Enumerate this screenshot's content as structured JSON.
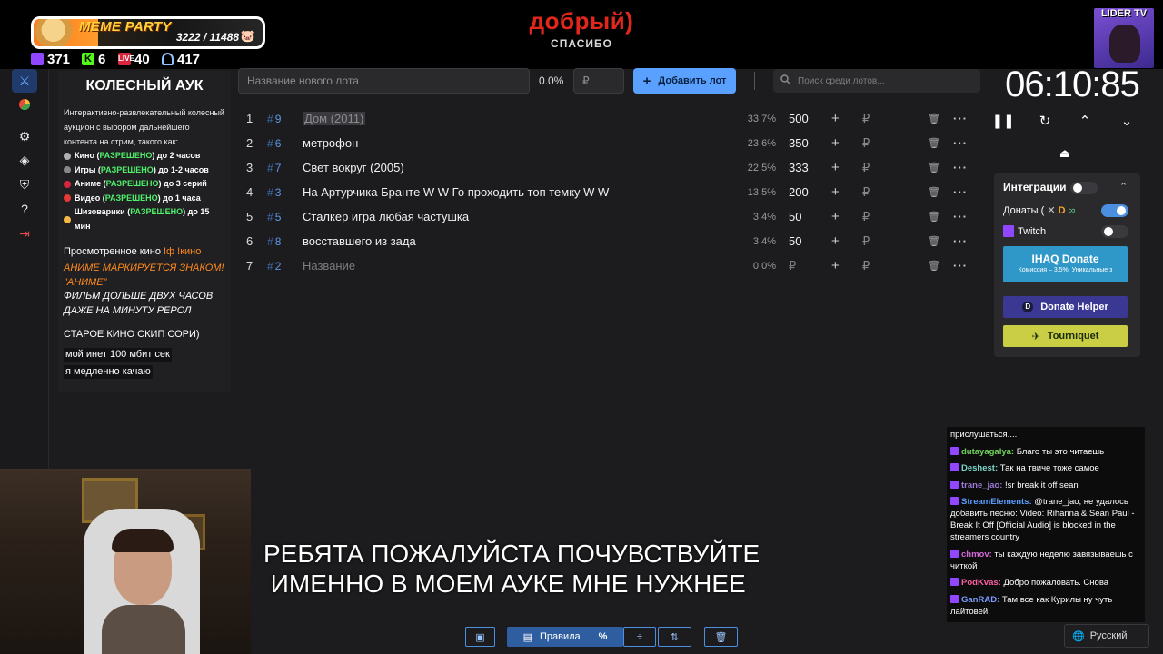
{
  "overlay": {
    "meme_party": {
      "title": "MEME PARTY",
      "count": "3222 / 11488",
      "progress": 0.28,
      "pig": "🐷"
    },
    "stats": {
      "twitch": "371",
      "kick": "6",
      "vk": "40",
      "viewers": "417",
      "vk_badge": "LIVE",
      "kick_badge": "K"
    },
    "thanks": {
      "main": "добрый)",
      "sub": "СПАСИБО"
    },
    "lider": {
      "label": "LIDER TV"
    }
  },
  "sidebar": {
    "icons": [
      "wheel-icon",
      "pie-chart-icon",
      "gear-icon",
      "layers-icon",
      "shield-icon",
      "help-icon",
      "logout-icon"
    ]
  },
  "description": {
    "title": "КОЛЕСНЫЙ АУК",
    "intro": "Интерактивно-развлекательный колесный аукцион с выбором дальнейшего контента на стрим, такого как:",
    "rules": [
      {
        "pre": "Кино (",
        "ok": "РАЗРЕШЕНО",
        "post": ") до 2 часов",
        "color": "#b0b0b0"
      },
      {
        "pre": "Игры (",
        "ok": "РАЗРЕШЕНО",
        "post": ") до 1-2 часов",
        "color": "#888888"
      },
      {
        "pre": "Аниме (",
        "ok": "РАЗРЕШЕНО",
        "post": ") до 3 серий",
        "color": "#d9263f"
      },
      {
        "pre": "Видео (",
        "ok": "РАЗРЕШЕНО",
        "post": ") до 1 часа",
        "color": "#e53935"
      },
      {
        "pre": "Шизоварики (",
        "ok": "РАЗРЕШЕНО",
        "post": ") до 15 мин",
        "color": "#f5b942"
      }
    ],
    "watched_label": "Просмотренное кино ",
    "watched_cmd": "!ф !кино",
    "orange_lines": [
      "АНИМЕ МАРКИРУЕТСЯ ЗНАКОМ!",
      "\"АНИМЕ\""
    ],
    "white_lines": [
      "ФИЛЬМ ДОЛЬШЕ ДВУХ ЧАСОВ",
      "ДАЖЕ НА МИНУТУ РЕРОЛ"
    ],
    "old_movies": "СТАРОЕ КИНО СКИП СОРИ)",
    "boxed_lines": [
      "мой инет 100 мбит сек",
      "я медленно качаю"
    ]
  },
  "controls": {
    "lot_placeholder": "Название нового лота",
    "total_percent": "0.0%",
    "amount_placeholder": "₽",
    "add_lot_label": "Добавить лот",
    "search_placeholder": "Поиск среди лотов..."
  },
  "lots": [
    {
      "idx": "1",
      "fid": "9",
      "name": "Дом (2011)",
      "pct": "33.7%",
      "amount": "500"
    },
    {
      "idx": "2",
      "fid": "6",
      "name": "метрофон",
      "pct": "23.6%",
      "amount": "350"
    },
    {
      "idx": "3",
      "fid": "7",
      "name": "Свет вокруг (2005)",
      "pct": "22.5%",
      "amount": "333"
    },
    {
      "idx": "4",
      "fid": "3",
      "name": "На Артурчика Бранте W W Го проходить топ темку W W",
      "pct": "13.5%",
      "amount": "200"
    },
    {
      "idx": "5",
      "fid": "5",
      "name": "Сталкер игра любая частушка",
      "pct": "3.4%",
      "amount": "50"
    },
    {
      "idx": "6",
      "fid": "8",
      "name": "восставшего из зада",
      "pct": "3.4%",
      "amount": "50"
    },
    {
      "idx": "7",
      "fid": "2",
      "name": "Название",
      "pct": "0.0%",
      "amount": "₽"
    }
  ],
  "currency_symbol": "₽",
  "timer": {
    "value": "06:10:85"
  },
  "integrations": {
    "title": "Интеграции",
    "donations_label": "Донаты (",
    "twitch_label": "Twitch",
    "ihaq_title": "IHAQ Donate",
    "ihaq_sub": "Комиссия – 3,5%. Уникальные з",
    "donate_helper": "Donate Helper",
    "tourniquet": "Tourniquet",
    "master_on": false,
    "donations_on": true,
    "twitch_on": false
  },
  "chat": [
    {
      "user": "",
      "color": "#ffffff",
      "text": "прислушаться...."
    },
    {
      "user": "dutayagalya:",
      "color": "#6fd35a",
      "text": " Благо ты это читаешь"
    },
    {
      "user": "Deshest:",
      "color": "#7ad6c9",
      "text": " Так на твиче тоже самое"
    },
    {
      "user": "trane_jao:",
      "color": "#9b7ad6",
      "text": " !sr break it off sean"
    },
    {
      "user": "StreamElements:",
      "color": "#5b9cff",
      "text": " @trane_jao, не удалось добавить песню: Video: Rihanna & Sean Paul - Break It Off [Official Audio] is blocked in the streamers country"
    },
    {
      "user": "chmov:",
      "color": "#d36ad6",
      "text": " ты каждую неделю завязываешь с читкой"
    },
    {
      "user": "PodKvas:",
      "color": "#ff5fa2",
      "text": " Добро пожаловать. Снова"
    },
    {
      "user": "GanRAD:",
      "color": "#7a9cff",
      "text": " Там все как Курилы ну чуть лайтовей"
    }
  ],
  "subtitle": {
    "line1": "РЕБЯТА ПОЖАЛУЙСТА ПОЧУВСТВУЙТЕ",
    "line2": " ИМЕННО В МОЕМ АУКЕ МНЕ НУЖНЕЕ"
  },
  "toolbar": {
    "rules_label": "Правила",
    "percent_label": "%"
  },
  "language": {
    "label": "Русский"
  }
}
